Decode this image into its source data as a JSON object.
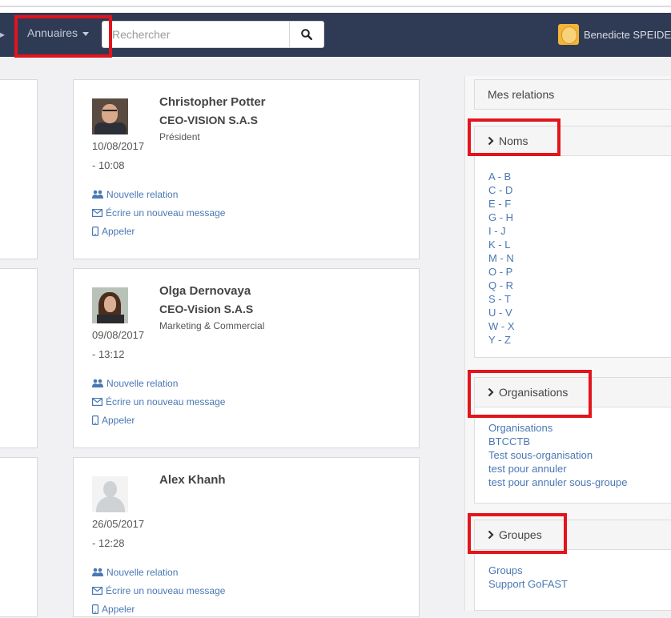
{
  "navbar": {
    "annuaires_label": "Annuaires",
    "search_placeholder": "Rechercher",
    "user_name": "Benedicte SPEIDEL"
  },
  "contacts": [
    {
      "name": "Christopher Potter",
      "org": "CEO-VISION S.A.S",
      "role": "Président",
      "date": "10/08/2017",
      "time": "- 10:08",
      "photo": "photo-portrait-man"
    },
    {
      "name": "Olga Dernovaya",
      "org": "CEO-Vision S.A.S",
      "role": "Marketing & Commercial",
      "date": "09/08/2017",
      "time": "- 13:12",
      "photo": "photo-portrait-woman"
    },
    {
      "name": "Alex Khanh",
      "org": "",
      "role": "",
      "date": "26/05/2017",
      "time": "- 12:28",
      "photo": "default-avatar"
    }
  ],
  "card_actions": {
    "new_relation": "Nouvelle relation",
    "new_message": "Écrire un nouveau message",
    "call": "Appeler"
  },
  "sidebar": {
    "mes_relations": "Mes relations",
    "noms": {
      "title": "Noms",
      "items": [
        "A - B",
        "C - D",
        "E - F",
        "G - H",
        "I - J",
        "K - L",
        "M - N",
        "O - P",
        "Q - R",
        "S - T",
        "U - V",
        "W - X",
        "Y - Z"
      ]
    },
    "organisations": {
      "title": "Organisations",
      "items": [
        "Organisations",
        "BTCCTB",
        "Test sous-organisation",
        "test pour annuler",
        "test pour annuler sous-groupe"
      ]
    },
    "groupes": {
      "title": "Groupes",
      "items": [
        "Groups",
        "Support GoFAST"
      ]
    }
  },
  "colors": {
    "navbar": "#2f3b54",
    "link": "#4a78b4",
    "highlight": "#e3141c"
  }
}
